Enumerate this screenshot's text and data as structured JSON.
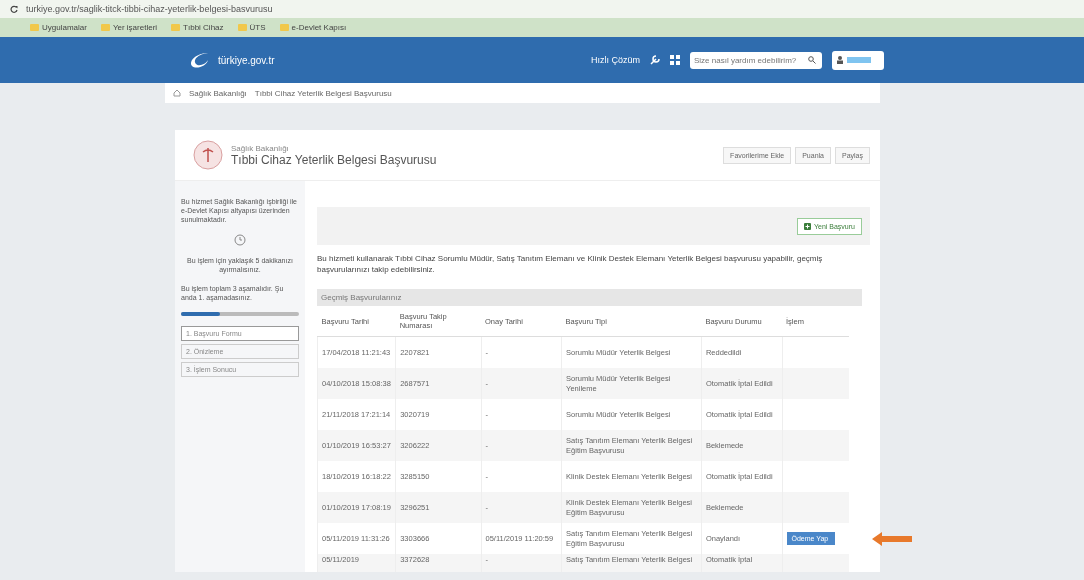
{
  "browser": {
    "url": "turkiye.gov.tr/saglik-titck-tibbi-cihaz-yeterlik-belgesi-basvurusu",
    "bookmarks": [
      "Uygulamalar",
      "Yer işaretleri",
      "Tıbbi Cihaz",
      "ÜTS",
      "e-Devlet Kapısı"
    ]
  },
  "header": {
    "logo": "türkiye.gov.tr",
    "quick": "Hızlı Çözüm",
    "search": {
      "placeholder": "Size nasıl yardım edebilirim?"
    }
  },
  "breadcrumb": [
    "Sağlık Bakanlığı",
    "Tıbbi Cihaz Yeterlik Belgesi Başvurusu"
  ],
  "service": {
    "agency": "Sağlık Bakanlığı",
    "title": "Tıbbi Cihaz Yeterlik Belgesi Başvurusu",
    "actions": [
      "Favorilerime Ekle",
      "Puanla",
      "Paylaş"
    ]
  },
  "sidebar": {
    "info": "Bu hizmet Sağlık Bakanlığı işbirliği ile e-Devlet Kapısı altyapısı üzerinden sunulmaktadır.",
    "time": "Bu işlem için yaklaşık 5 dakikanızı ayırmalısınız.",
    "progress_text": "Bu işlem toplam 3 aşamalıdır. Şu anda 1. aşamadasınız.",
    "level": 0.33,
    "steps": [
      {
        "label": "1. Başvuru Formu",
        "selected": true
      },
      {
        "label": "2. Önizleme",
        "selected": false
      },
      {
        "label": "3. İşlem Sonucu",
        "selected": false
      }
    ]
  },
  "new_button": "Yeni Başvuru",
  "intro": "Bu hizmeti kullanarak Tıbbi Cihaz Sorumlu Müdür, Satış Tanıtım Elemanı ve Klinik Destek Elemanı Yeterlik Belgesi başvurusu yapabilir, geçmiş başvurularınızı takip edebilirsiniz.",
  "table": {
    "title": "Geçmiş Başvurularınız",
    "columns": [
      "Başvuru Tarihi",
      "Başvuru Takip Numarası",
      "Onay Tarihi",
      "Başvuru Tipi",
      "Başvuru Durumu",
      "İşlem"
    ],
    "rows": [
      {
        "cells": [
          "17/04/2018 11:21:43",
          "2207821",
          "-",
          "Sorumlu Müdür Yeterlik Belgesi",
          "Reddedildi"
        ]
      },
      {
        "cells": [
          "04/10/2018 15:08:38",
          "2687571",
          "-",
          "Sorumlu Müdür Yeterlik Belgesi Yenileme",
          "Otomatik İptal Edildi"
        ]
      },
      {
        "cells": [
          "21/11/2018 17:21:14",
          "3020719",
          "-",
          "Sorumlu Müdür Yeterlik Belgesi",
          "Otomatik İptal Edildi"
        ]
      },
      {
        "cells": [
          "01/10/2019 16:53:27",
          "3206222",
          "-",
          "Satış Tanıtım Elemanı Yeterlik Belgesi Eğitim Başvurusu",
          "Beklemede"
        ]
      },
      {
        "cells": [
          "18/10/2019 16:18:22",
          "3285150",
          "-",
          "Klinik Destek Elemanı Yeterlik Belgesi",
          "Otomatik İptal Edildi"
        ]
      },
      {
        "cells": [
          "01/10/2019 17:08:19",
          "3296251",
          "-",
          "Klinik Destek Elemanı Yeterlik Belgesi Eğitim Başvurusu",
          "Beklemede"
        ]
      },
      {
        "cells": [
          "05/11/2019 11:31:26",
          "3303666",
          "05/11/2019 11:20:59",
          "Satış Tanıtım Elemanı Yeterlik Belgesi Eğitim Başvurusu",
          "Onaylandı"
        ],
        "action": "Ödeme Yap"
      },
      {
        "cells": [
          "05/11/2019",
          "3372628",
          "-",
          "Satış Tanıtım Elemanı Yeterlik Belgesi",
          "Otomatik İptal"
        ]
      }
    ]
  }
}
